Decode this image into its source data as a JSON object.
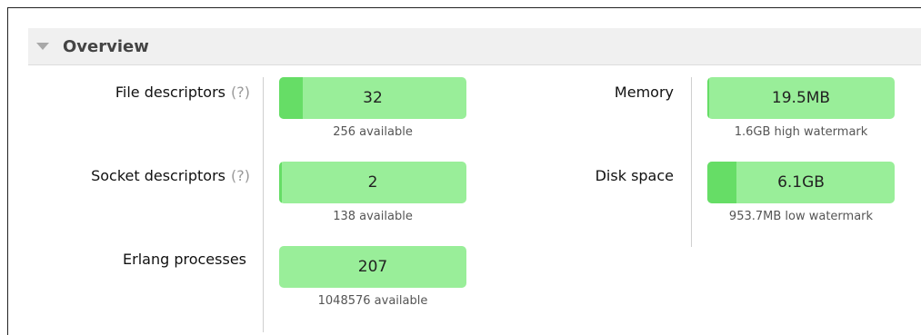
{
  "overview": {
    "title": "Overview",
    "help_label": "(?)",
    "metrics_left": [
      {
        "label": "File descriptors",
        "value": "32",
        "sub": "256 available",
        "fill_fraction": 0.125,
        "has_help": true
      },
      {
        "label": "Socket descriptors",
        "value": "2",
        "sub": "138 available",
        "fill_fraction": 0.0145,
        "has_help": true
      },
      {
        "label": "Erlang processes",
        "value": "207",
        "sub": "1048576 available",
        "fill_fraction": 0.0002,
        "has_help": false
      }
    ],
    "metrics_right": [
      {
        "label": "Memory",
        "value": "19.5MB",
        "sub": "1.6GB high watermark",
        "fill_fraction": 0.012
      },
      {
        "label": "Disk space",
        "value": "6.1GB",
        "sub": "953.7MB low watermark",
        "fill_fraction": 0.16
      }
    ]
  },
  "colors": {
    "bar_bg": "#99ee99",
    "bar_fill": "#66dd66",
    "header_bg": "#f0f0f0"
  }
}
